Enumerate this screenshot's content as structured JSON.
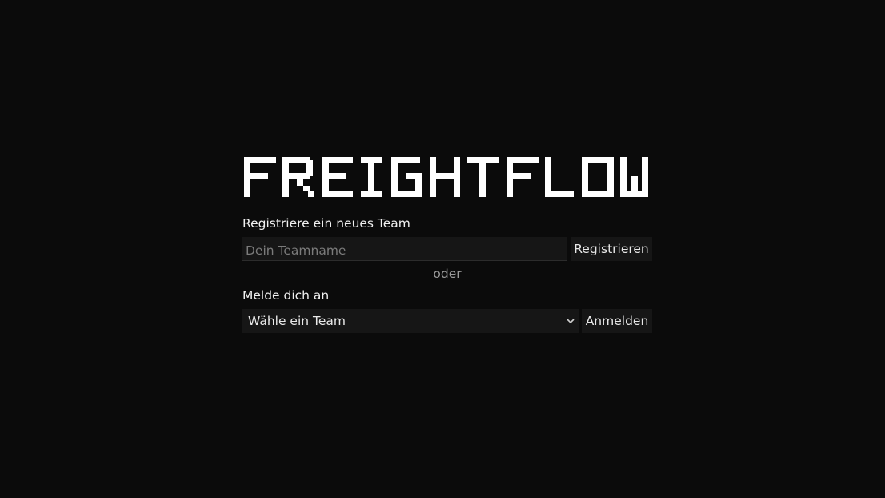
{
  "app": {
    "logo_text": "FREIGHT FLOW"
  },
  "register": {
    "heading": "Registriere ein neues Team",
    "team_name_placeholder": "Dein Teamname",
    "team_name_value": "",
    "button_label": "Registrieren"
  },
  "separator": {
    "text": "oder"
  },
  "login": {
    "heading": "Melde dich an",
    "team_select_value": "Wähle ein Team",
    "button_label": "Anmelden"
  },
  "icons": {
    "select_arrow": "chevron-down-icon"
  },
  "colors": {
    "background": "#0b0b0b",
    "control_background": "#161616",
    "text": "#f2f2f2",
    "muted_text": "#9a9a9a",
    "placeholder": "#7b7b7b"
  }
}
